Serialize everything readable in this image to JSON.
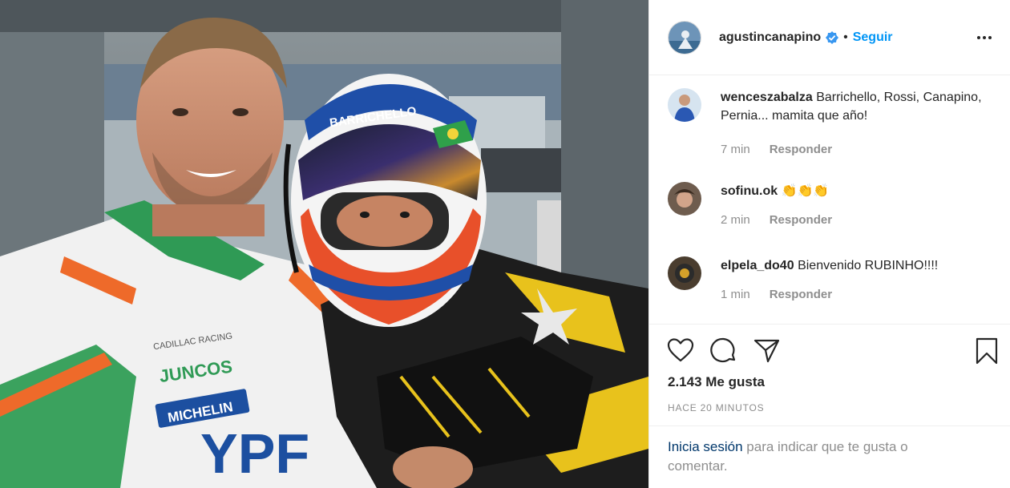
{
  "post": {
    "author": {
      "username": "agustincanapino",
      "verified": true,
      "separator": "•",
      "follow_label": "Seguir",
      "avatar_icon": "profile-avatar"
    },
    "photo": {
      "helmet_text": "BARRICHELLO",
      "sponsor_juncos": "JUNCOS",
      "sponsor_juncos_sub": "RACING",
      "sponsor_cadillac": "CADILLAC RACING",
      "sponsor_michelin": "MICHELIN",
      "sponsor_ypf": "YPF"
    },
    "comments": [
      {
        "user": "wenceszabalza",
        "text": "Barrichello, Rossi, Canapino, Pernia... mamita que año!",
        "time": "7 min",
        "reply_label": "Responder"
      },
      {
        "user": "sofinu.ok",
        "text": "👏👏👏",
        "time": "2 min",
        "reply_label": "Responder"
      },
      {
        "user": "elpela_do40",
        "text": "Bienvenido RUBINHO!!!!",
        "time": "1 min",
        "reply_label": "Responder"
      }
    ],
    "likes_text": "2.143 Me gusta",
    "time_ago": "HACE 20 MINUTOS",
    "login_prompt": {
      "link": "Inicia sesión",
      "rest": " para indicar que te gusta o comentar."
    },
    "icons": [
      "heart-icon",
      "comment-icon",
      "share-icon",
      "bookmark-icon",
      "more-icon",
      "verified-icon"
    ],
    "colors": {
      "accent": "#0095f6",
      "text": "#262626",
      "muted": "#8e8e8e",
      "link_dark": "#00376b",
      "verified": "#3897f0"
    }
  }
}
